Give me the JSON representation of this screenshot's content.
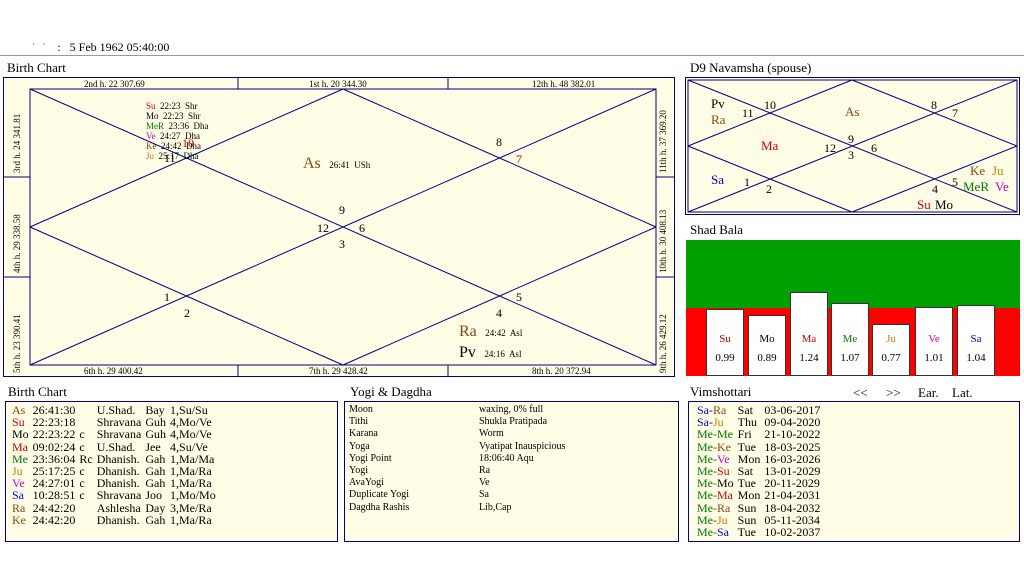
{
  "header": {
    "prefix": ":",
    "datetime": "5 Feb 1962  05:40:00"
  },
  "birth_chart": {
    "title": "Birth Chart",
    "borders": {
      "top": [
        "2nd h.  22  307.69",
        "1st h.  20  344.30",
        "12th h.  48  382.01"
      ],
      "bottom": [
        "6th h.  29  400.42",
        "7th h.  29  428.42",
        "8th h.  20  372.94"
      ],
      "left": [
        "3rd h.  24  341.81",
        "4th h.  29  338.58",
        "5th h.  23  390.41"
      ],
      "right": [
        "11th h.  37  369.20",
        "10th h.  30  408.13",
        "9th h.  26  429.12"
      ]
    },
    "house_numbers": [
      "11",
      "10",
      "9",
      "12",
      "6",
      "3",
      "8",
      "7",
      "1",
      "2",
      "5",
      "4"
    ],
    "house2_planets": [
      {
        "name": "Su",
        "deg": "22:23",
        "nak": "Shr",
        "color": "#cc0000"
      },
      {
        "name": "Mo",
        "deg": "22:23",
        "nak": "Shr",
        "color": "#000000"
      },
      {
        "name": "MeR",
        "deg": "23:36",
        "nak": "Dha",
        "color": "#007a00"
      },
      {
        "name": "Ve",
        "deg": "24:27",
        "nak": "Dha",
        "color": "#d000d0"
      },
      {
        "name": "Ke",
        "deg": "24:42",
        "nak": "Dha",
        "color": "#8b4513"
      },
      {
        "name": "Ju",
        "deg": "25:17",
        "nak": "Dha",
        "color": "#cc7a00"
      }
    ],
    "asc": {
      "name": "As",
      "deg": "26:41",
      "nak": "USh"
    },
    "h8_planets": [
      {
        "name": "Ra",
        "deg": "24:42",
        "nak": "Asl"
      },
      {
        "name": "Pv",
        "deg": "24:16",
        "nak": "Asl"
      }
    ]
  },
  "navamsha": {
    "title": "D9 Navamsha  (spouse)",
    "numbers": [
      "10",
      "11",
      "8",
      "7",
      "9",
      "12",
      "3",
      "6",
      "1",
      "2",
      "4",
      "5"
    ],
    "planets": [
      {
        "name": "Pv",
        "color": "#000000"
      },
      {
        "name": "Ra",
        "color": "#8b4513"
      },
      {
        "name": "As",
        "color": "#8b4513"
      },
      {
        "name": "Ma",
        "color": "#cc0000"
      },
      {
        "name": "Sa",
        "color": "#0000cc"
      },
      {
        "name": "Ke",
        "color": "#8b4513"
      },
      {
        "name": "Ju",
        "color": "#cc7a00"
      },
      {
        "name": "MeR",
        "color": "#007a00"
      },
      {
        "name": "Ve",
        "color": "#d000d0"
      },
      {
        "name": "Su",
        "color": "#cc0000"
      },
      {
        "name": "Mo",
        "color": "#000000"
      }
    ]
  },
  "shad_bala": {
    "title": "Shad Bala",
    "bars": [
      {
        "planet": "Su",
        "value": "0.99",
        "color": "#cc0000"
      },
      {
        "planet": "Mo",
        "value": "0.89",
        "color": "#000000"
      },
      {
        "planet": "Ma",
        "value": "1.24",
        "color": "#cc0000"
      },
      {
        "planet": "Me",
        "value": "1.07",
        "color": "#007a00"
      },
      {
        "planet": "Ju",
        "value": "0.77",
        "color": "#cc7a00"
      },
      {
        "planet": "Ve",
        "value": "1.01",
        "color": "#d000d0"
      },
      {
        "planet": "Sa",
        "value": "1.04",
        "color": "#0000cc"
      }
    ]
  },
  "birth_list": {
    "title": "Birth Chart",
    "rows": [
      {
        "p": "As",
        "deg": "26:41:30",
        "flag": "",
        "nak": "U.Shad.",
        "b": "Bay",
        "pada": "1,Su/Su",
        "color": "#8b4513"
      },
      {
        "p": "Su",
        "deg": "22:23:18",
        "flag": "",
        "nak": "Shravana",
        "b": "Guh",
        "pada": "4,Mo/Ve",
        "color": "#cc0000"
      },
      {
        "p": "Mo",
        "deg": "22:23:22",
        "flag": "c",
        "nak": "Shravana",
        "b": "Guh",
        "pada": "4,Mo/Ve",
        "color": "#000000"
      },
      {
        "p": "Ma",
        "deg": "09:02:24",
        "flag": "c",
        "nak": "U.Shad.",
        "b": "Jee",
        "pada": "4,Su/Ve",
        "color": "#cc0000"
      },
      {
        "p": "Me",
        "deg": "23:36:04",
        "flag": "Rc",
        "nak": "Dhanish.",
        "b": "Gah",
        "pada": "1,Ma/Ma",
        "color": "#007a00"
      },
      {
        "p": "Ju",
        "deg": "25:17:25",
        "flag": "c",
        "nak": "Dhanish.",
        "b": "Gah",
        "pada": "1,Ma/Ra",
        "color": "#cc7a00"
      },
      {
        "p": "Ve",
        "deg": "24:27:01",
        "flag": "c",
        "nak": "Dhanish.",
        "b": "Gah",
        "pada": "1,Ma/Ra",
        "color": "#d000d0"
      },
      {
        "p": "Sa",
        "deg": "10:28:51",
        "flag": "c",
        "nak": "Shravana",
        "b": "Joo",
        "pada": "1,Mo/Mo",
        "color": "#0000cc"
      },
      {
        "p": "Ra",
        "deg": "24:42:20",
        "flag": "",
        "nak": "Ashlesha",
        "b": "Day",
        "pada": "3,Me/Ra",
        "color": "#8b4513"
      },
      {
        "p": "Ke",
        "deg": "24:42:20",
        "flag": "",
        "nak": "Dhanish.",
        "b": "Gah",
        "pada": "1,Ma/Ra",
        "color": "#8b4513"
      }
    ]
  },
  "yogi": {
    "title": "Yogi & Dagdha",
    "rows": [
      {
        "k": "Moon",
        "v": "waxing, 0% full"
      },
      {
        "k": "Tithi",
        "v": "Shukla  Pratipada"
      },
      {
        "k": "Karana",
        "v": "Worm"
      },
      {
        "k": "Yoga",
        "v": "Vyatipat Inauspicious"
      },
      {
        "k": "Yogi Point",
        "v": "18:06:40 Aqu"
      },
      {
        "k": "Yogi",
        "v": "Ra"
      },
      {
        "k": "AvaYogi",
        "v": "Ve"
      },
      {
        "k": "Duplicate Yogi",
        "v": "Sa"
      },
      {
        "k": "Dagdha Rashis",
        "v": "Lib,Cap"
      }
    ]
  },
  "vimshottari": {
    "title": "Vimshottari",
    "nav": {
      "prev": "<<",
      "next": ">>",
      "ear": "Ear.",
      "lat": "Lat."
    },
    "rows": [
      {
        "p1": "Sa",
        "p2": "Ra",
        "c1": "#0000cc",
        "c2": "#8b4513",
        "day": "Sat",
        "date": "03-06-2017"
      },
      {
        "p1": "Sa",
        "p2": "Ju",
        "c1": "#0000cc",
        "c2": "#cc7a00",
        "day": "Thu",
        "date": "09-04-2020"
      },
      {
        "p1": "Me",
        "p2": "Me",
        "c1": "#007a00",
        "c2": "#007a00",
        "day": "Fri",
        "date": "21-10-2022"
      },
      {
        "p1": "Me",
        "p2": "Ke",
        "c1": "#007a00",
        "c2": "#8b4513",
        "day": "Tue",
        "date": "18-03-2025"
      },
      {
        "p1": "Me",
        "p2": "Ve",
        "c1": "#007a00",
        "c2": "#d000d0",
        "day": "Mon",
        "date": "16-03-2026"
      },
      {
        "p1": "Me",
        "p2": "Su",
        "c1": "#007a00",
        "c2": "#cc0000",
        "day": "Sat",
        "date": "13-01-2029"
      },
      {
        "p1": "Me",
        "p2": "Mo",
        "c1": "#007a00",
        "c2": "#000000",
        "day": "Tue",
        "date": "20-11-2029"
      },
      {
        "p1": "Me",
        "p2": "Ma",
        "c1": "#007a00",
        "c2": "#cc0000",
        "day": "Mon",
        "date": "21-04-2031"
      },
      {
        "p1": "Me",
        "p2": "Ra",
        "c1": "#007a00",
        "c2": "#8b4513",
        "day": "Sun",
        "date": "18-04-2032"
      },
      {
        "p1": "Me",
        "p2": "Ju",
        "c1": "#007a00",
        "c2": "#cc7a00",
        "day": "Sun",
        "date": "05-11-2034"
      },
      {
        "p1": "Me",
        "p2": "Sa",
        "c1": "#007a00",
        "c2": "#0000cc",
        "day": "Tue",
        "date": "10-02-2037"
      }
    ]
  }
}
